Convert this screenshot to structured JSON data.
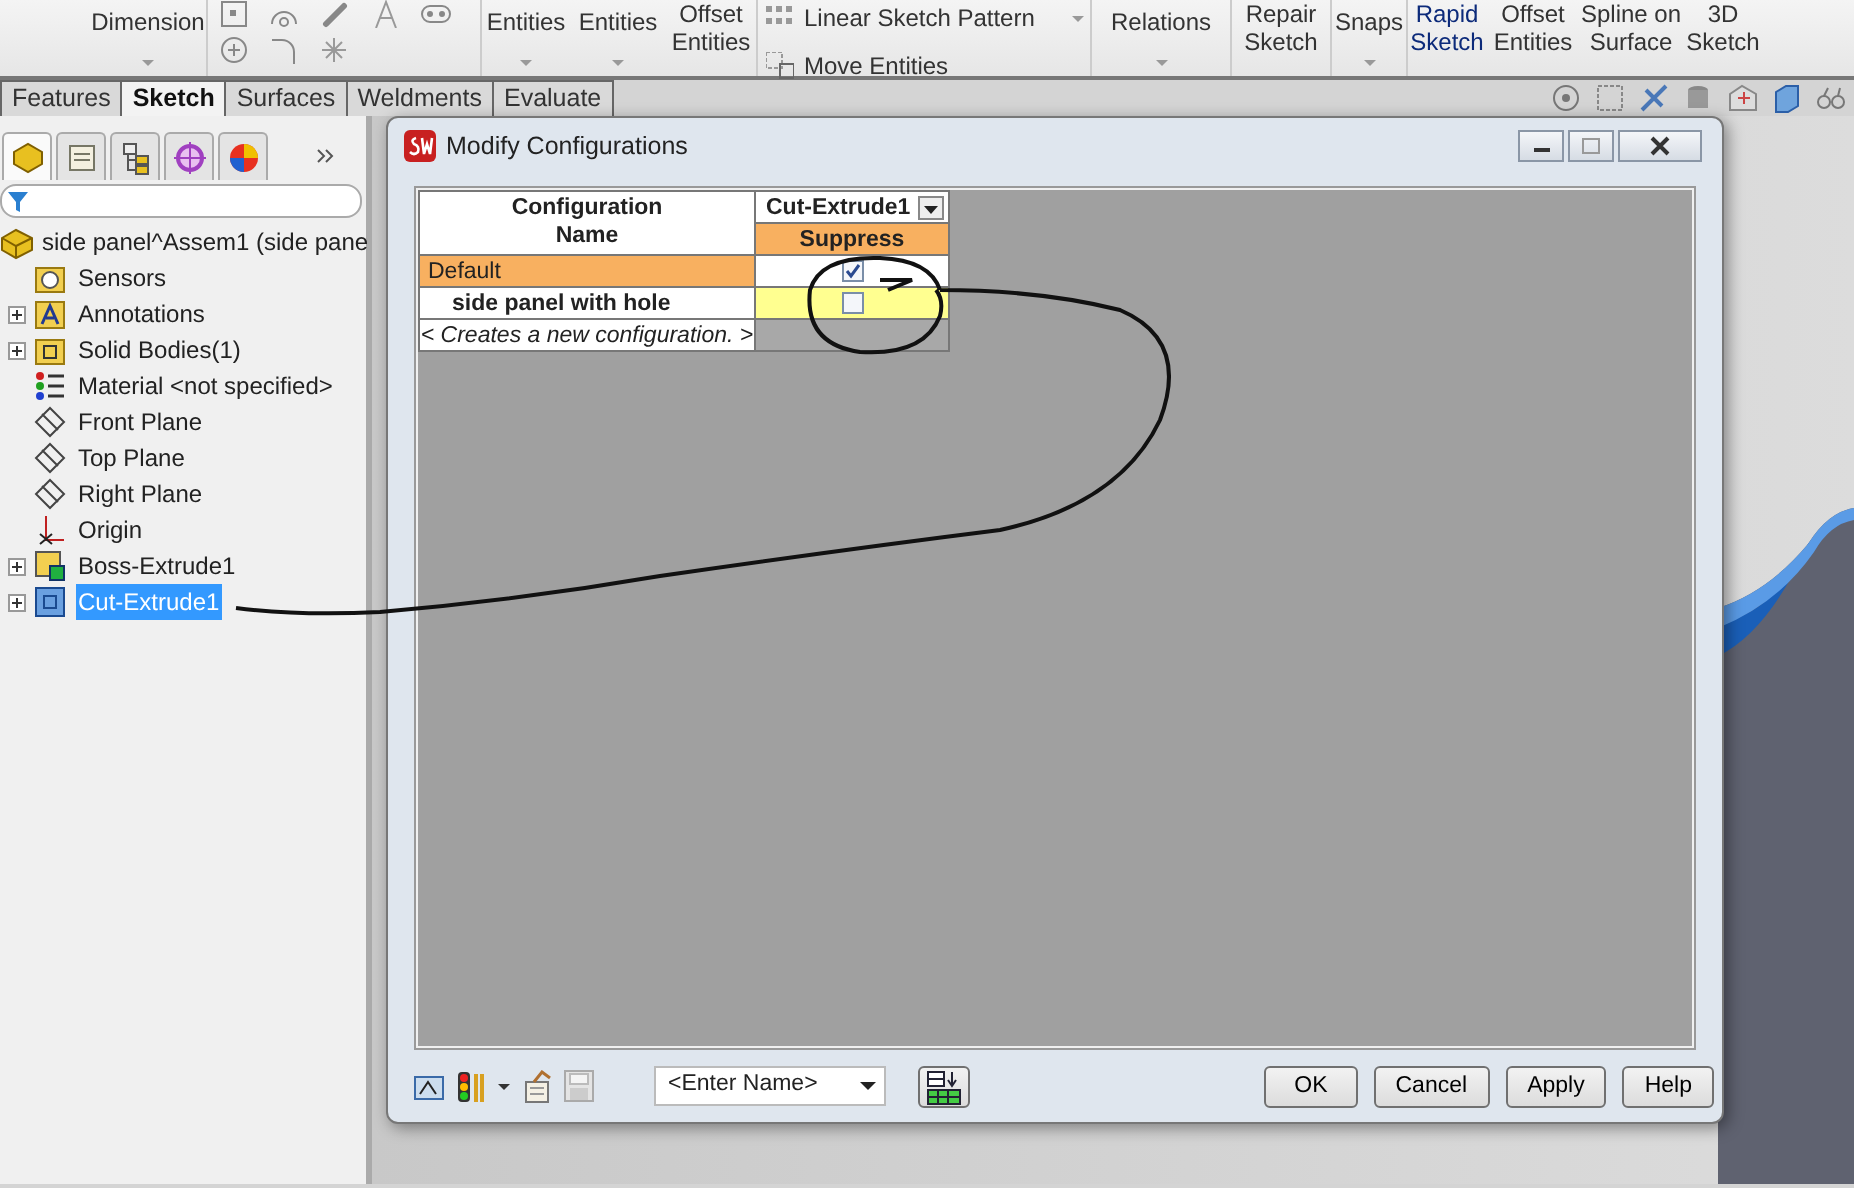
{
  "toolbar": {
    "items": [
      {
        "kind": "large",
        "lines": [
          "Dimension"
        ],
        "dropdown": true,
        "active": false
      },
      {
        "kind": "large",
        "lines": [
          "Entities"
        ],
        "dropdown": true,
        "active": false
      },
      {
        "kind": "large",
        "lines": [
          "Entities"
        ],
        "dropdown": true,
        "active": false
      },
      {
        "kind": "large",
        "lines": [
          "Offset",
          "Entities"
        ],
        "dropdown": false,
        "active": false
      },
      {
        "kind": "pair",
        "lines": [
          "Linear Sketch Pattern",
          "Move Entities"
        ],
        "dropdown": true,
        "active": false
      },
      {
        "kind": "large",
        "lines": [
          "Relations"
        ],
        "dropdown": true,
        "active": false
      },
      {
        "kind": "large",
        "lines": [
          "Repair",
          "Sketch"
        ],
        "dropdown": false,
        "active": false
      },
      {
        "kind": "large",
        "lines": [
          "Snaps"
        ],
        "dropdown": true,
        "active": false
      },
      {
        "kind": "large",
        "lines": [
          "Rapid",
          "Sketch"
        ],
        "dropdown": false,
        "active": true
      },
      {
        "kind": "large",
        "lines": [
          "Offset",
          "Entities"
        ],
        "dropdown": false,
        "active": false
      },
      {
        "kind": "large",
        "lines": [
          "Spline on",
          "Surface"
        ],
        "dropdown": false,
        "active": false
      },
      {
        "kind": "large",
        "lines": [
          "3D",
          "Sketch"
        ],
        "dropdown": false,
        "active": false
      }
    ]
  },
  "tabs": [
    {
      "label": "Features",
      "selected": false
    },
    {
      "label": "Sketch",
      "selected": true
    },
    {
      "label": "Surfaces",
      "selected": false
    },
    {
      "label": "Weldments",
      "selected": false
    },
    {
      "label": "Evaluate",
      "selected": false
    }
  ],
  "panel_tabs": [
    {
      "kind": "features",
      "selected": true
    },
    {
      "kind": "properties",
      "selected": false
    },
    {
      "kind": "configurations",
      "selected": false
    },
    {
      "kind": "target",
      "selected": false
    },
    {
      "kind": "appearance",
      "selected": false
    }
  ],
  "tree": {
    "label": "side panel^Assem1  (side pane",
    "selected": false,
    "children": [
      {
        "label": "Sensors",
        "kind": "sensors",
        "selected": false
      },
      {
        "label": "Annotations",
        "kind": "annotations",
        "expanded": false,
        "selected": false
      },
      {
        "label": "Solid Bodies(1)",
        "kind": "bodies",
        "expanded": false,
        "selected": false
      },
      {
        "label": "Material <not specified>",
        "kind": "material",
        "selected": false
      },
      {
        "label": "Front Plane",
        "kind": "plane",
        "selected": false
      },
      {
        "label": "Top Plane",
        "kind": "plane",
        "selected": false
      },
      {
        "label": "Right Plane",
        "kind": "plane",
        "selected": false
      },
      {
        "label": "Origin",
        "kind": "origin",
        "selected": false
      },
      {
        "label": "Boss-Extrude1",
        "kind": "boss",
        "expanded": false,
        "selected": false
      },
      {
        "label": "Cut-Extrude1",
        "kind": "cut",
        "expanded": false,
        "selected": true
      }
    ]
  },
  "dialog": {
    "title": "Modify Configurations",
    "table": {
      "name_header": "Configuration Name",
      "feature": "Cut-Extrude1",
      "parameter": "Suppress",
      "rows": [
        {
          "kind": "config",
          "name": "Default",
          "selected": true,
          "active": false,
          "suppress": true
        },
        {
          "kind": "config",
          "name": "side panel with hole",
          "selected": false,
          "active": true,
          "suppress": false
        },
        {
          "kind": "new",
          "name": "< Creates a new configuration. >"
        }
      ]
    },
    "name_field": {
      "value": "<Enter Name>"
    },
    "buttons": [
      "OK",
      "Cancel",
      "Apply",
      "Help"
    ]
  }
}
